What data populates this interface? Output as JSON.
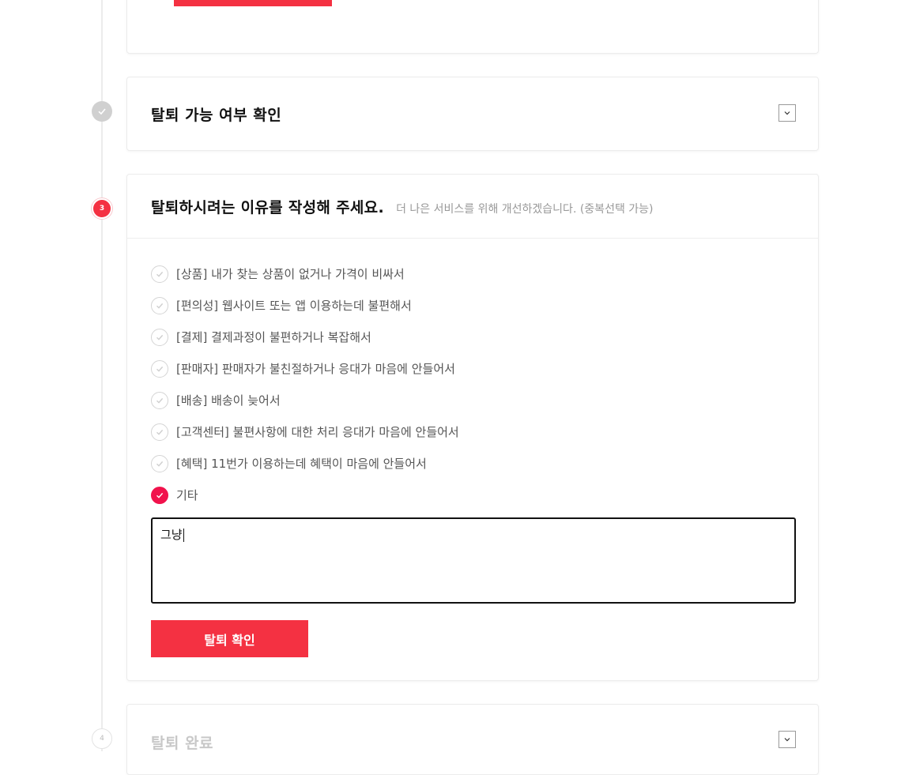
{
  "steps": {
    "step2": {
      "title": "탈퇴 가능 여부 확인",
      "icon": "check-icon"
    },
    "step3": {
      "number": "3",
      "title": "탈퇴하시려는 이유를 작성해 주세요.",
      "subtitle": "더 나은 서비스를 위해 개선하겠습니다. (중복선택 가능)",
      "options": [
        {
          "label": "[상품] 내가 찾는 상품이 없거나 가격이 비싸서",
          "checked": false
        },
        {
          "label": "[편의성] 웹사이트 또는 앱 이용하는데 불편해서",
          "checked": false
        },
        {
          "label": "[결제] 결제과정이 불편하거나 복잡해서",
          "checked": false
        },
        {
          "label": "[판매자] 판매자가 불친절하거나 응대가 마음에 안들어서",
          "checked": false
        },
        {
          "label": "[배송] 배송이 늦어서",
          "checked": false
        },
        {
          "label": "[고객센터] 불편사항에 대한 처리 응대가 마음에 안들어서",
          "checked": false
        },
        {
          "label": "[혜택] 11번가 이용하는데 혜택이 마음에 안들어서",
          "checked": false
        },
        {
          "label": "기타",
          "checked": true
        }
      ],
      "reason_text": "그냥",
      "confirm_label": "탈퇴 확인"
    },
    "step4": {
      "number": "4",
      "title": "탈퇴 완료"
    }
  },
  "colors": {
    "accent": "#f43142",
    "checked": "#f1124c",
    "done": "#d0d0d0"
  }
}
